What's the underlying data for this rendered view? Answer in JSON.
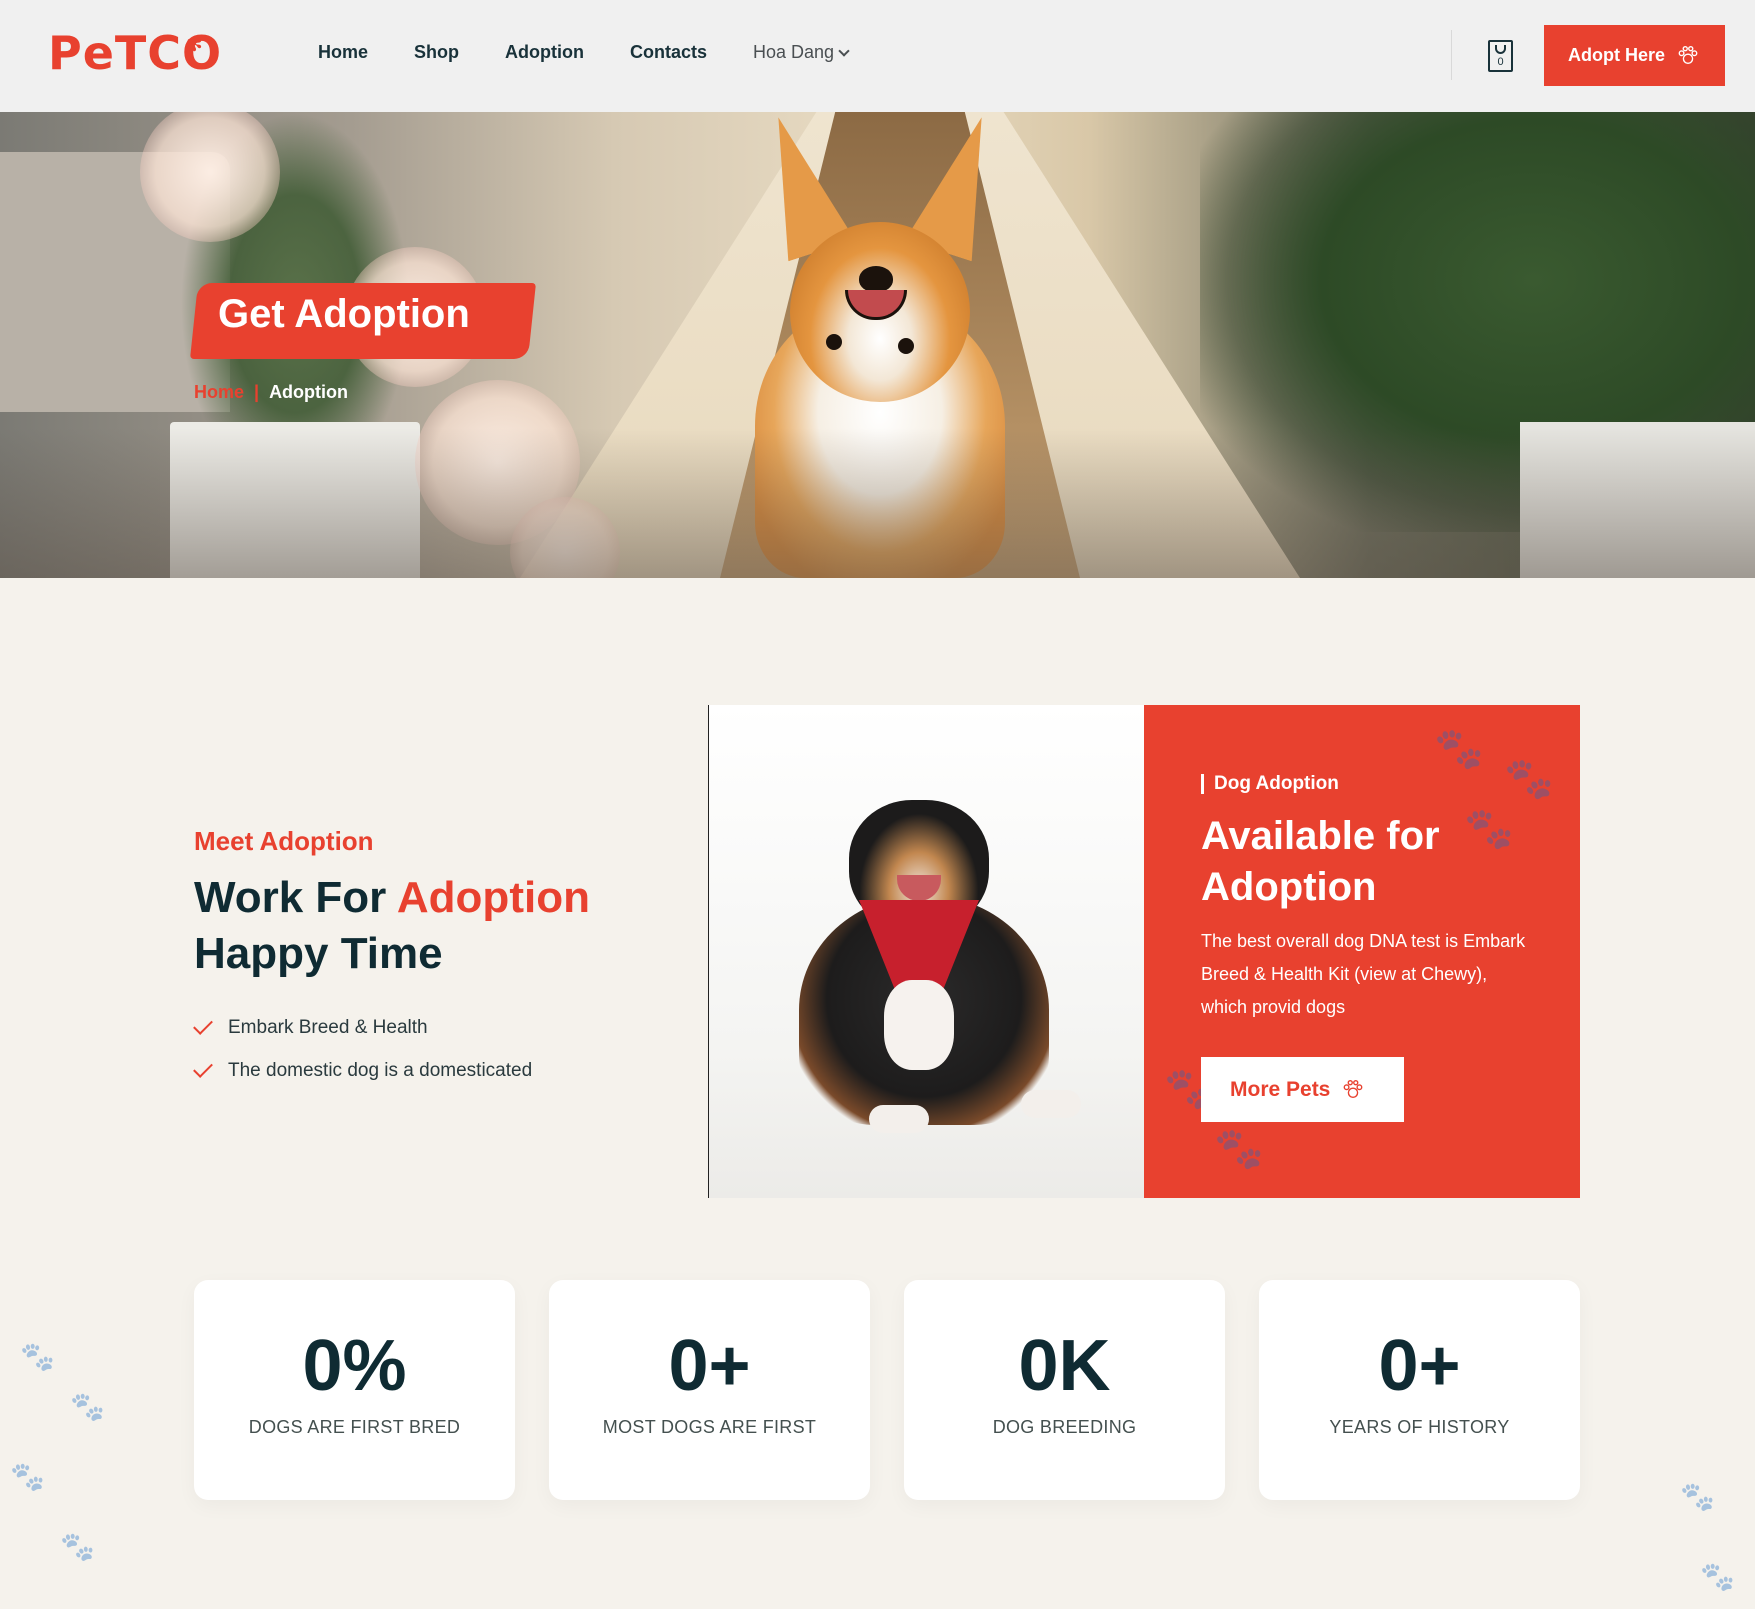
{
  "header": {
    "logo": "PeTCO",
    "nav": [
      "Home",
      "Shop",
      "Adoption",
      "Contacts"
    ],
    "user": "Hoa Dang",
    "cart_count": "0",
    "adopt_button": "Adopt Here"
  },
  "hero": {
    "title": "Get Adoption",
    "breadcrumb": {
      "home": "Home",
      "separator": "|",
      "current": "Adoption"
    }
  },
  "meet": {
    "kicker": "Meet Adoption",
    "heading_part1": "Work For ",
    "heading_accent": "Adoption",
    "heading_part2": "Happy Time",
    "checklist": [
      "Embark Breed & Health",
      "The domestic dog is a domesticated"
    ]
  },
  "promo": {
    "kicker": "Dog Adoption",
    "title": "Available for Adoption",
    "text": "The best overall dog DNA test is Embark Breed & Health Kit (view at Chewy), which provid dogs",
    "button": "More Pets"
  },
  "stats": [
    {
      "value": "0%",
      "label": "DOGS ARE FIRST BRED"
    },
    {
      "value": "0+",
      "label": "MOST DOGS ARE FIRST"
    },
    {
      "value": "0K",
      "label": "DOG BREEDING"
    },
    {
      "value": "0+",
      "label": "YEARS OF HISTORY"
    }
  ],
  "colors": {
    "accent": "#e8412f",
    "dark": "#0f2b33",
    "background": "#f5f2ec"
  }
}
